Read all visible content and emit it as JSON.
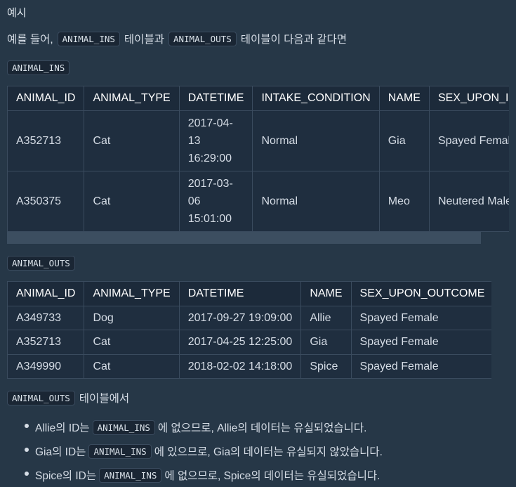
{
  "heading": "예시",
  "intro": {
    "before": "예를 들어,",
    "code1": "ANIMAL_INS",
    "middle": "테이블과",
    "code2": "ANIMAL_OUTS",
    "after": "테이블이 다음과 같다면"
  },
  "ins_label": "ANIMAL_INS",
  "ins_table": {
    "headers": [
      "ANIMAL_ID",
      "ANIMAL_TYPE",
      "DATETIME",
      "INTAKE_CONDITION",
      "NAME",
      "SEX_UPON_INTAKE"
    ],
    "rows": [
      [
        "A352713",
        "Cat",
        "2017-04-13 16:29:00",
        "Normal",
        "Gia",
        "Spayed Female"
      ],
      [
        "A350375",
        "Cat",
        "2017-03-06 15:01:00",
        "Normal",
        "Meo",
        "Neutered Male"
      ]
    ]
  },
  "outs_label": "ANIMAL_OUTS",
  "outs_table": {
    "headers": [
      "ANIMAL_ID",
      "ANIMAL_TYPE",
      "DATETIME",
      "NAME",
      "SEX_UPON_OUTCOME"
    ],
    "rows": [
      [
        "A349733",
        "Dog",
        "2017-09-27 19:09:00",
        "Allie",
        "Spayed Female"
      ],
      [
        "A352713",
        "Cat",
        "2017-04-25 12:25:00",
        "Gia",
        "Spayed Female"
      ],
      [
        "A349990",
        "Cat",
        "2018-02-02 14:18:00",
        "Spice",
        "Spayed Female"
      ]
    ]
  },
  "outs_note": {
    "code": "ANIMAL_OUTS",
    "text": "테이블에서"
  },
  "bullets": [
    {
      "before": "Allie의 ID는",
      "code": "ANIMAL_INS",
      "after": "에 없으므로, Allie의 데이터는 유실되었습니다."
    },
    {
      "before": "Gia의 ID는",
      "code": "ANIMAL_INS",
      "after": "에 있으므로, Gia의 데이터는 유실되지 않았습니다."
    },
    {
      "before": "Spice의 ID는",
      "code": "ANIMAL_INS",
      "after": "에 없으므로, Spice의 데이터는 유실되었습니다."
    }
  ]
}
